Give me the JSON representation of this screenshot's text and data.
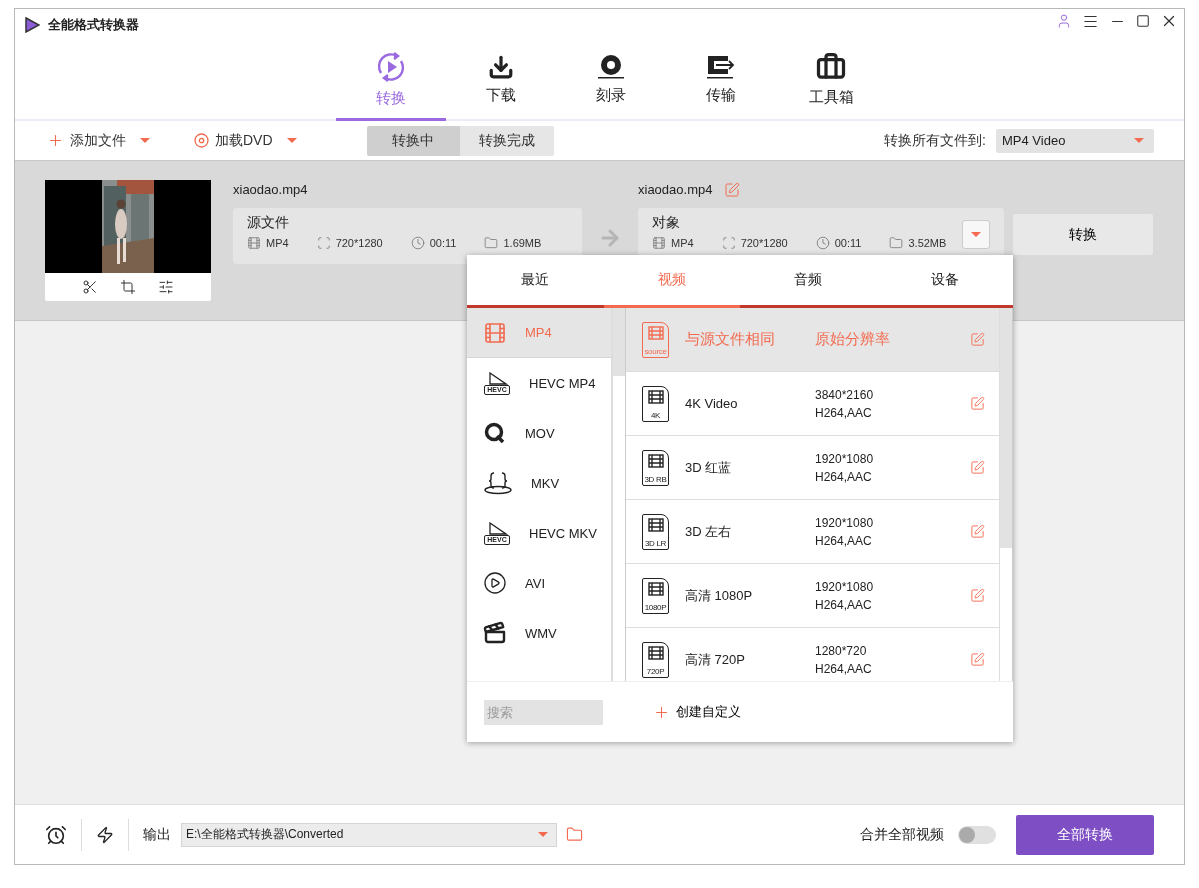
{
  "window": {
    "title": "全能格式转换器"
  },
  "nav": [
    {
      "label": "转换",
      "kind": "convert",
      "selected": true
    },
    {
      "label": "下载",
      "kind": "download",
      "selected": false
    },
    {
      "label": "刻录",
      "kind": "burn",
      "selected": false
    },
    {
      "label": "传输",
      "kind": "transfer",
      "selected": false
    },
    {
      "label": "工具箱",
      "kind": "toolbox",
      "selected": false
    }
  ],
  "toolbar": {
    "add_file": "添加文件",
    "load_dvd": "加载DVD",
    "status_tabs": [
      {
        "label": "转换中",
        "selected": true
      },
      {
        "label": "转换完成",
        "selected": false
      }
    ],
    "convert_all_label": "转换所有文件到:",
    "format": "MP4 Video"
  },
  "file": {
    "source_name": "xiaodao.mp4",
    "source_label": "源文件",
    "source_info": {
      "format": "MP4",
      "resolution": "720*1280",
      "duration": "00:11",
      "size": "1.69MB"
    },
    "target_name": "xiaodao.mp4",
    "target_label": "对象",
    "target_info": {
      "format": "MP4",
      "resolution": "720*1280",
      "duration": "00:11",
      "size": "3.52MB"
    },
    "convert_button": "转换"
  },
  "format_popup": {
    "tabs": [
      {
        "label": "最近",
        "selected": false
      },
      {
        "label": "视频",
        "selected": true
      },
      {
        "label": "音频",
        "selected": false
      },
      {
        "label": "设备",
        "selected": false
      }
    ],
    "categories": [
      {
        "label": "MP4",
        "kind": "film",
        "selected": true
      },
      {
        "label": "HEVC MP4",
        "kind": "hevc",
        "badge": "HEVC",
        "selected": false
      },
      {
        "label": "MOV",
        "kind": "q",
        "selected": false
      },
      {
        "label": "MKV",
        "kind": "braces",
        "selected": false
      },
      {
        "label": "HEVC MKV",
        "kind": "hevc",
        "badge": "HEVC",
        "selected": false
      },
      {
        "label": "AVI",
        "kind": "play",
        "selected": false
      },
      {
        "label": "WMV",
        "kind": "clapper",
        "selected": false
      }
    ],
    "presets": [
      {
        "badge": "source",
        "name": "与源文件相同",
        "lines": [
          "原始分辨率"
        ],
        "selected": true
      },
      {
        "badge": "4K",
        "name": "4K Video",
        "lines": [
          "3840*2160",
          "H264,AAC"
        ],
        "selected": false
      },
      {
        "badge": "3D RB",
        "name": "3D 红蓝",
        "lines": [
          "1920*1080",
          "H264,AAC"
        ],
        "selected": false
      },
      {
        "badge": "3D LR",
        "name": "3D 左右",
        "lines": [
          "1920*1080",
          "H264,AAC"
        ],
        "selected": false
      },
      {
        "badge": "1080P",
        "name": "高清 1080P",
        "lines": [
          "1920*1080",
          "H264,AAC"
        ],
        "selected": false
      },
      {
        "badge": "720P",
        "name": "高清 720P",
        "lines": [
          "1280*720",
          "H264,AAC"
        ],
        "selected": false
      }
    ],
    "search": {
      "placeholder": "搜索"
    },
    "create_custom": "创建自定义"
  },
  "bottom": {
    "output_label": "输出",
    "output_path": "E:\\全能格式转换器\\Converted",
    "merge_label": "合并全部视频",
    "merge_on": false,
    "convert_all": "全部转换"
  }
}
